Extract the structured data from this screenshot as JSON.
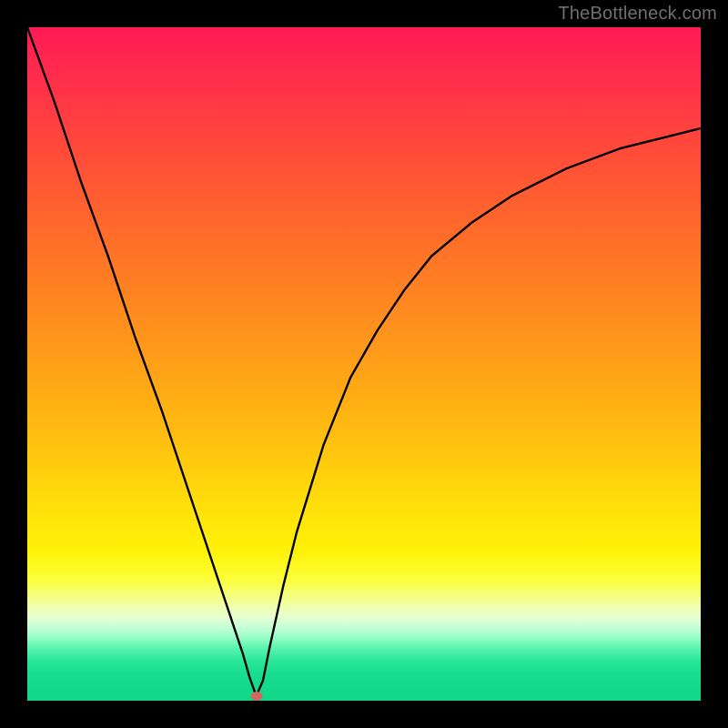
{
  "watermark": "TheBottleneck.com",
  "marker": {
    "x_pct": 34.0,
    "y_pct": 99.3
  },
  "chart_data": {
    "type": "line",
    "title": "",
    "xlabel": "",
    "ylabel": "",
    "xlim": [
      0,
      100
    ],
    "ylim": [
      0,
      100
    ],
    "series": [
      {
        "name": "curve",
        "x": [
          0,
          4,
          8,
          12,
          16,
          20,
          24,
          28,
          30,
          32,
          33,
          34,
          35,
          36,
          38,
          40,
          44,
          48,
          52,
          56,
          60,
          66,
          72,
          80,
          88,
          96,
          100
        ],
        "y": [
          100,
          89,
          77,
          66,
          54,
          43,
          31,
          19,
          13,
          7,
          3.5,
          0.7,
          3,
          8,
          17,
          25,
          38,
          48,
          55,
          61,
          66,
          71,
          75,
          79,
          82,
          84,
          85
        ]
      }
    ],
    "annotations": [
      {
        "type": "point",
        "x": 34,
        "y": 0.7,
        "label": "min-marker",
        "color": "#d4665e"
      }
    ],
    "background_gradient": {
      "direction": "vertical",
      "stops": [
        {
          "pct": 0,
          "color": "#ff1a55"
        },
        {
          "pct": 50,
          "color": "#ffaa14"
        },
        {
          "pct": 80,
          "color": "#fff208"
        },
        {
          "pct": 92,
          "color": "#60f5b0"
        },
        {
          "pct": 100,
          "color": "#10d688"
        }
      ]
    }
  }
}
